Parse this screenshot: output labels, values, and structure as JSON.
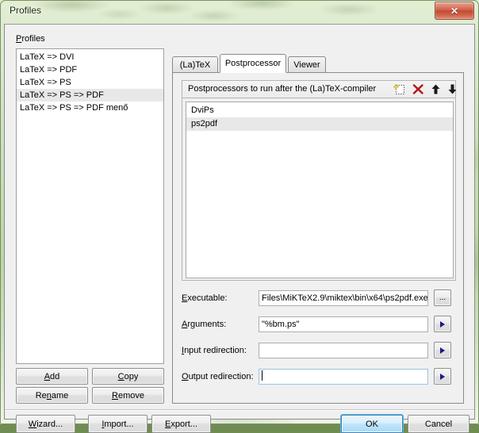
{
  "window": {
    "title": "Profiles",
    "close_label": "✕",
    "close_icon": "close-icon",
    "frame_color": "#c4dbb2",
    "client_bg": "#f0f0f0"
  },
  "profiles_panel": {
    "label": "Profiles",
    "label_mnemonic": "P",
    "items": [
      {
        "label": "LaTeX => DVI",
        "selected": false
      },
      {
        "label": "LaTeX => PDF",
        "selected": false
      },
      {
        "label": "LaTeX => PS",
        "selected": false
      },
      {
        "label": "LaTeX => PS => PDF",
        "selected": true
      },
      {
        "label": "LaTeX => PS => PDF menő",
        "selected": false
      }
    ],
    "buttons": [
      {
        "label": "Add",
        "mnemonic": "A"
      },
      {
        "label": "Copy",
        "mnemonic": "C"
      },
      {
        "label": "Rename",
        "mnemonic": "n"
      },
      {
        "label": "Remove",
        "mnemonic": "R"
      }
    ]
  },
  "tabs": [
    {
      "label": "(La)TeX",
      "active": false
    },
    {
      "label": "Postprocessor",
      "active": true
    },
    {
      "label": "Viewer",
      "active": false
    }
  ],
  "postprocessor_group": {
    "header": "Postprocessors to run after the (La)TeX-compiler",
    "toolbar": [
      {
        "name": "new-postprocessor-icon",
        "title": "New"
      },
      {
        "name": "delete-postprocessor-icon",
        "title": "Delete",
        "color": "#b01515"
      },
      {
        "name": "move-up-icon",
        "title": "Move up",
        "color": "#1a1a1a"
      },
      {
        "name": "move-down-icon",
        "title": "Move down",
        "color": "#1a1a1a"
      }
    ],
    "items": [
      {
        "label": "DviPs",
        "selected": false
      },
      {
        "label": "ps2pdf",
        "selected": true
      }
    ]
  },
  "fields": [
    {
      "label": "Executable:",
      "mnemonic": "E",
      "value": "Files\\MiKTeX2.9\\miktex\\bin\\x64\\ps2pdf.exe",
      "placeholder": "",
      "focused": false,
      "side_button": "...",
      "side_button_name": "browse-executable-button"
    },
    {
      "label": "Arguments:",
      "mnemonic": "A",
      "value": "\"%bm.ps\"",
      "placeholder": "",
      "focused": false,
      "side_button": "▶",
      "side_button_name": "arguments-menu-button"
    },
    {
      "label": "Input redirection:",
      "mnemonic": "I",
      "value": "",
      "placeholder": "",
      "focused": false,
      "side_button": "▶",
      "side_button_name": "input-redirection-menu-button"
    },
    {
      "label": "Output redirection:",
      "mnemonic": "O",
      "value": "",
      "placeholder": "",
      "focused": true,
      "side_button": "▶",
      "side_button_name": "output-redirection-menu-button"
    }
  ],
  "footer": {
    "left_buttons": [
      {
        "label": "Wizard...",
        "mnemonic": "W"
      },
      {
        "label": "Import...",
        "mnemonic": "I"
      },
      {
        "label": "Export...",
        "mnemonic": "E"
      }
    ],
    "ok_label": "OK",
    "cancel_label": "Cancel",
    "default_accent": "#3c7fb1"
  }
}
